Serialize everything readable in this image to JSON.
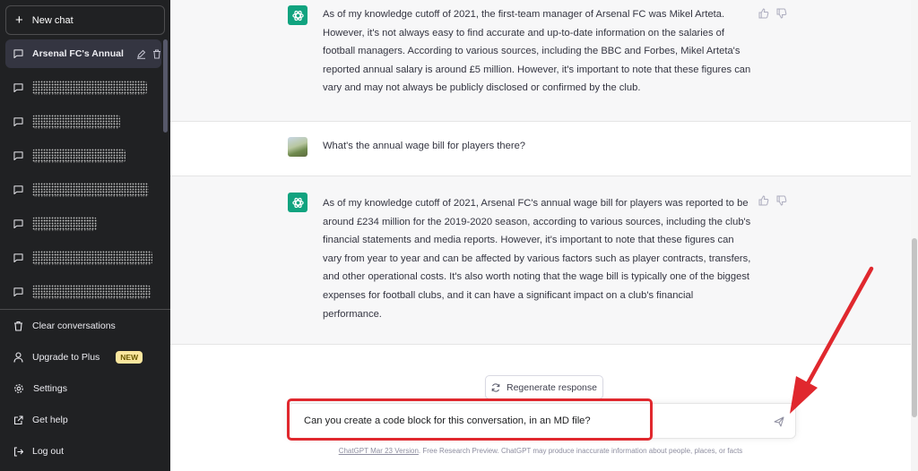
{
  "sidebar": {
    "new_chat": "New chat",
    "chats": [
      {
        "label": "Arsenal FC's Annual R",
        "active": true
      },
      {
        "label": "",
        "redacted": true
      },
      {
        "label": "",
        "redacted": true
      },
      {
        "label": "",
        "redacted": true
      },
      {
        "label": "",
        "redacted": true
      },
      {
        "label": "",
        "redacted": true
      },
      {
        "label": "",
        "redacted": true
      },
      {
        "label": "",
        "redacted": true
      }
    ],
    "menu": {
      "clear": "Clear conversations",
      "upgrade": "Upgrade to Plus",
      "upgrade_badge": "NEW",
      "settings": "Settings",
      "help": "Get help",
      "logout": "Log out"
    }
  },
  "conversation": {
    "assistant_1": "As of my knowledge cutoff of 2021, the first-team manager of Arsenal FC was Mikel Arteta. However, it's not always easy to find accurate and up-to-date information on the salaries of football managers. According to various sources, including the BBC and Forbes, Mikel Arteta's reported annual salary is around £5 million. However, it's important to note that these figures can vary and may not always be publicly disclosed or confirmed by the club.",
    "user_1": "What's the annual wage bill for players there?",
    "assistant_2": "As of my knowledge cutoff of 2021, Arsenal FC's annual wage bill for players was reported to be around £234 million for the 2019-2020 season, according to various sources, including the club's financial statements and media reports. However, it's important to note that these figures can vary from year to year and can be affected by various factors such as player contracts, transfers, and other operational costs. It's also worth noting that the wage bill is typically one of the biggest expenses for football clubs, and it can have a significant impact on a club's financial performance."
  },
  "composer": {
    "regenerate": "Regenerate response",
    "input_value": "Can you create a code block for this conversation, in an MD file?"
  },
  "footer": {
    "version_link": "ChatGPT Mar 23 Version",
    "disclaimer": ". Free Research Preview. ChatGPT may produce inaccurate information about people, places, or facts"
  },
  "colors": {
    "sidebar_bg": "#202123",
    "assistant_bg": "#f7f7f8",
    "brand_green": "#10a37f",
    "annotation_red": "#e0282e",
    "badge_yellow": "#fae69e"
  }
}
